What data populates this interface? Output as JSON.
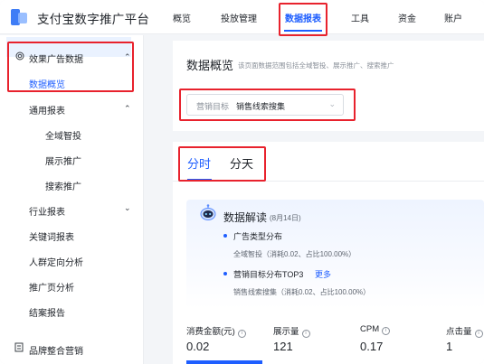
{
  "header": {
    "brand": "支付宝数字推广平台",
    "nav": [
      "概览",
      "投放管理",
      "数据报表",
      "工具",
      "资金",
      "账户"
    ],
    "active_nav": "数据报表"
  },
  "sidebar": {
    "group": "效果广告数据",
    "selected": "数据概览",
    "reports_label": "通用报表",
    "reports_items": [
      "全域智投",
      "展示推广",
      "搜索推广"
    ],
    "industry_label": "行业报表",
    "others": [
      "关键词报表",
      "人群定向分析",
      "推广页分析",
      "结案报告"
    ],
    "bottom": "品牌整合营销"
  },
  "main": {
    "title": "数据概览",
    "subtitle": "该页面数据范围包括全域智投、展示推广、搜索推广",
    "select_label": "营销目标",
    "select_value": "销售线索搜集",
    "tabs": [
      "分时",
      "分天"
    ],
    "insight": {
      "title": "数据解读",
      "date": "(8月14日)",
      "h1": "广告类型分布",
      "s1": "全域智投（消耗0.02、占比100.00%）",
      "h2": "营销目标分布TOP3",
      "more": "更多",
      "s2": "销售线索搜集（消耗0.02、占比100.00%）"
    },
    "metrics": [
      {
        "label": "消费金额(元)",
        "value": "0.02"
      },
      {
        "label": "展示量",
        "value": "121"
      },
      {
        "label": "CPM",
        "value": "0.17"
      },
      {
        "label": "点击量",
        "value": "1"
      }
    ]
  },
  "colors": {
    "accent": "#1e5eff",
    "highlight_box": "#e8222d"
  }
}
